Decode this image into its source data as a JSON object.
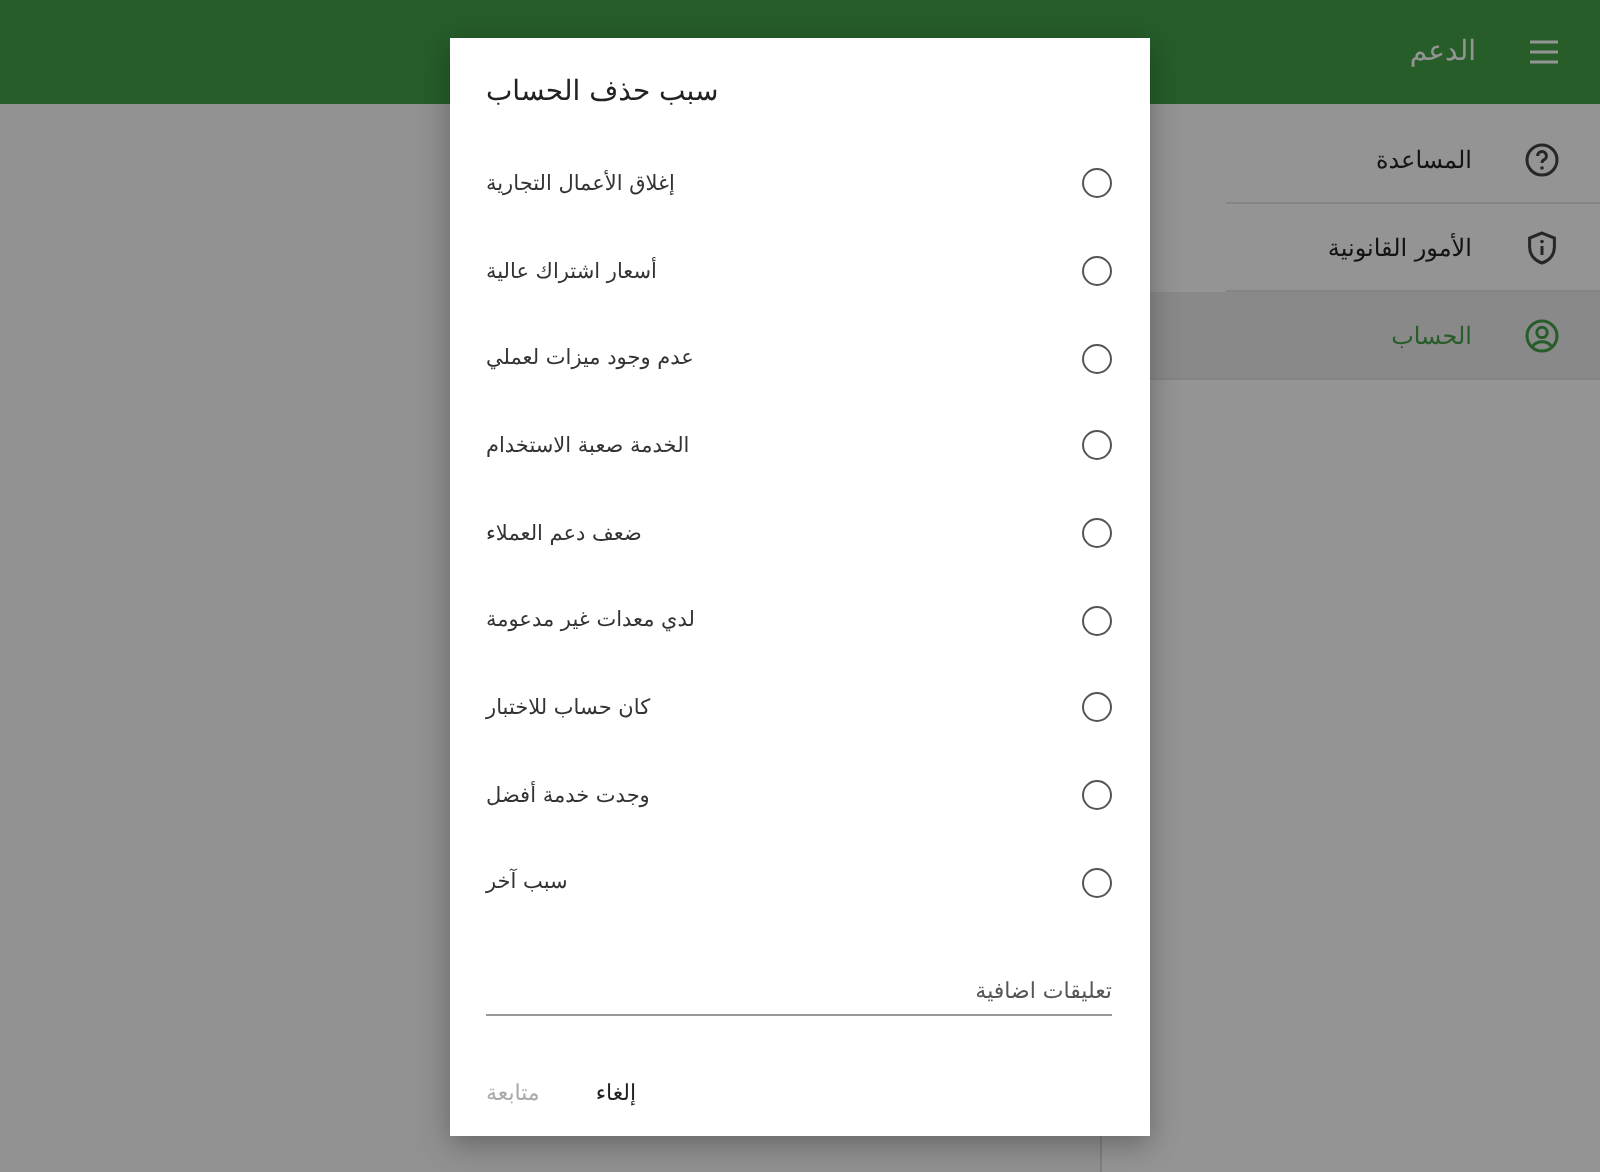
{
  "app_bar": {
    "title": "الدعم"
  },
  "sidebar": {
    "items": [
      {
        "label": "المساعدة",
        "kind": "help",
        "selected": false
      },
      {
        "label": "الأمور القانونية",
        "kind": "shield",
        "selected": false
      },
      {
        "label": "الحساب",
        "kind": "account",
        "selected": true
      }
    ]
  },
  "dialog": {
    "title": "سبب حذف الحساب",
    "options": [
      {
        "label": "إغلاق الأعمال التجارية",
        "selected": false
      },
      {
        "label": "أسعار اشتراك عالية",
        "selected": false
      },
      {
        "label": "عدم وجود ميزات لعملي",
        "selected": false
      },
      {
        "label": "الخدمة صعبة الاستخدام",
        "selected": false
      },
      {
        "label": "ضعف دعم العملاء",
        "selected": false
      },
      {
        "label": "لدي معدات غير مدعومة",
        "selected": false
      },
      {
        "label": "كان حساب للاختبار",
        "selected": false
      },
      {
        "label": "وجدت خدمة أفضل",
        "selected": false
      },
      {
        "label": "سبب آخر",
        "selected": false
      }
    ],
    "comment": {
      "placeholder": "تعليقات اضافية"
    },
    "buttons": [
      {
        "label": "إلغاء",
        "disabled": false
      },
      {
        "label": "متابعة",
        "disabled": true
      }
    ]
  }
}
